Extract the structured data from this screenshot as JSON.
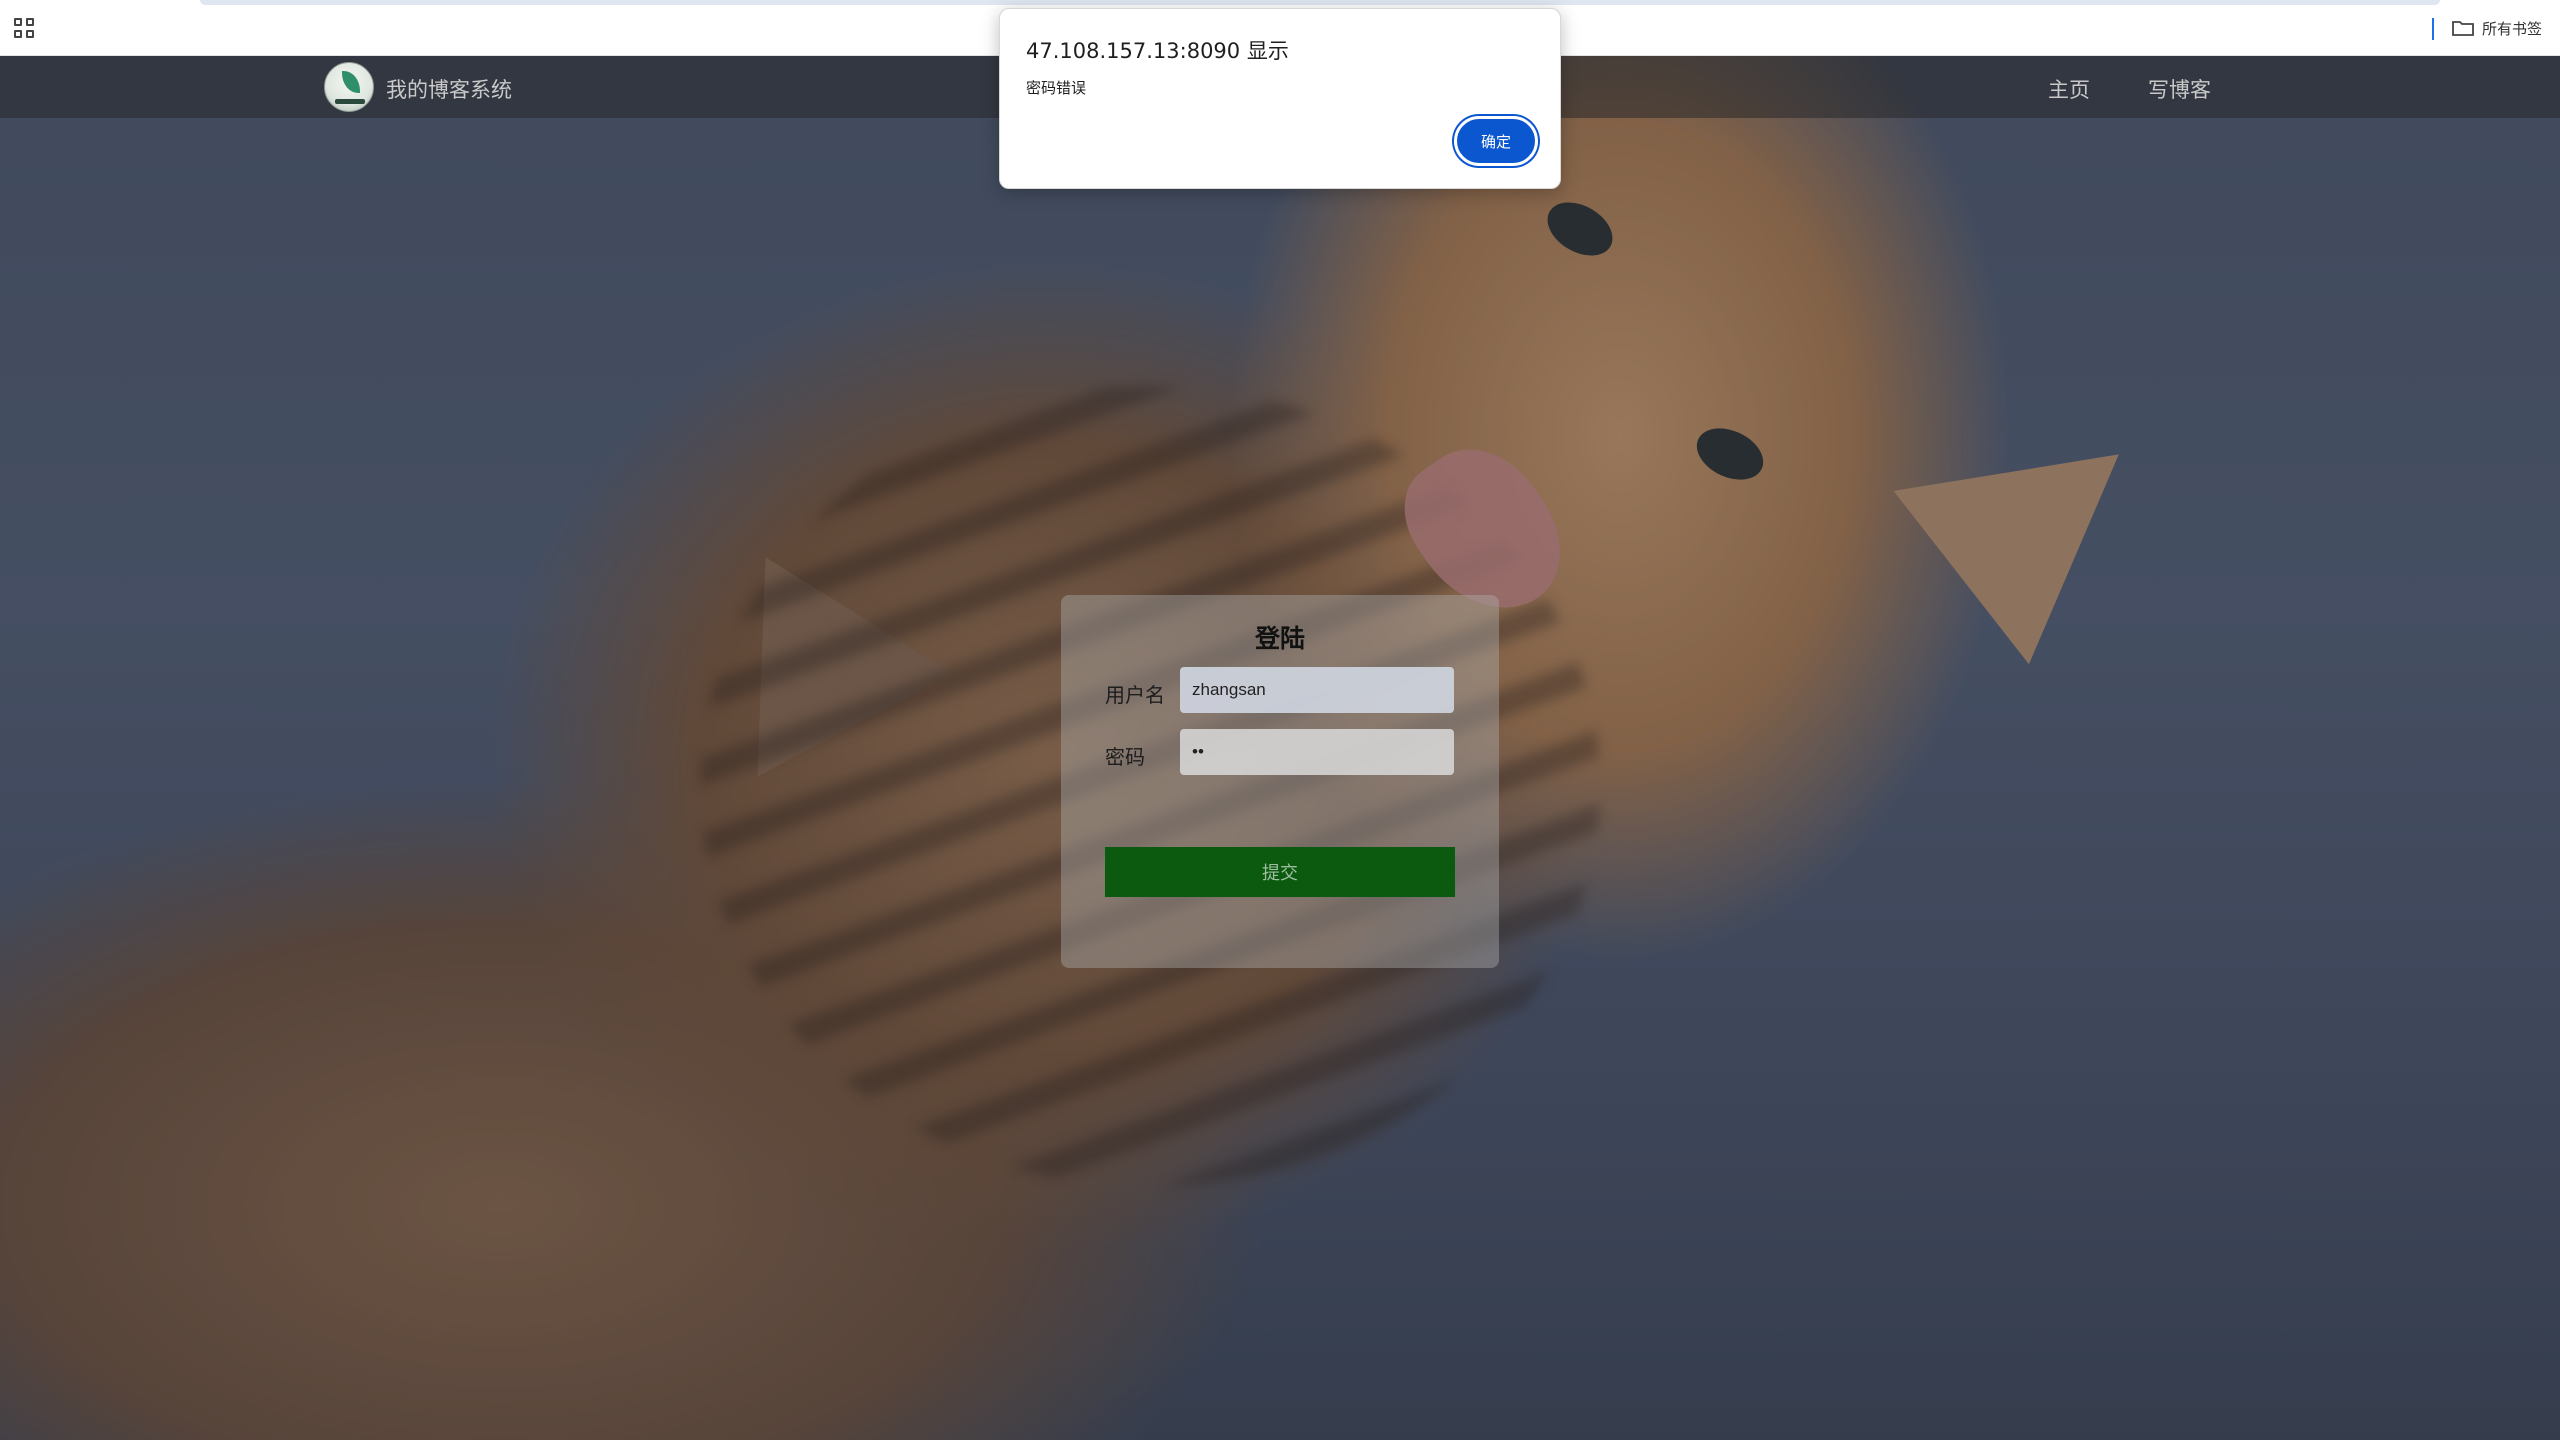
{
  "browser": {
    "bookmarks_bar": {
      "apps_icon": "apps-grid-icon",
      "all_bookmarks_label": "所有书签",
      "folder_icon": "folder-icon"
    }
  },
  "nav": {
    "site_title": "我的博客系统",
    "links": [
      {
        "label": "主页"
      },
      {
        "label": "写博客"
      }
    ]
  },
  "login": {
    "title": "登陆",
    "username_label": "用户名",
    "username_value": "zhangsan",
    "password_label": "密码",
    "password_value": "12",
    "submit_label": "提交"
  },
  "alert": {
    "title": "47.108.157.13:8090 显示",
    "message": "密码错误",
    "ok_label": "确定"
  },
  "colors": {
    "submit_button": "#0b5a10",
    "alert_button": "#0b57d0",
    "nav_overlay": "#28282a"
  }
}
